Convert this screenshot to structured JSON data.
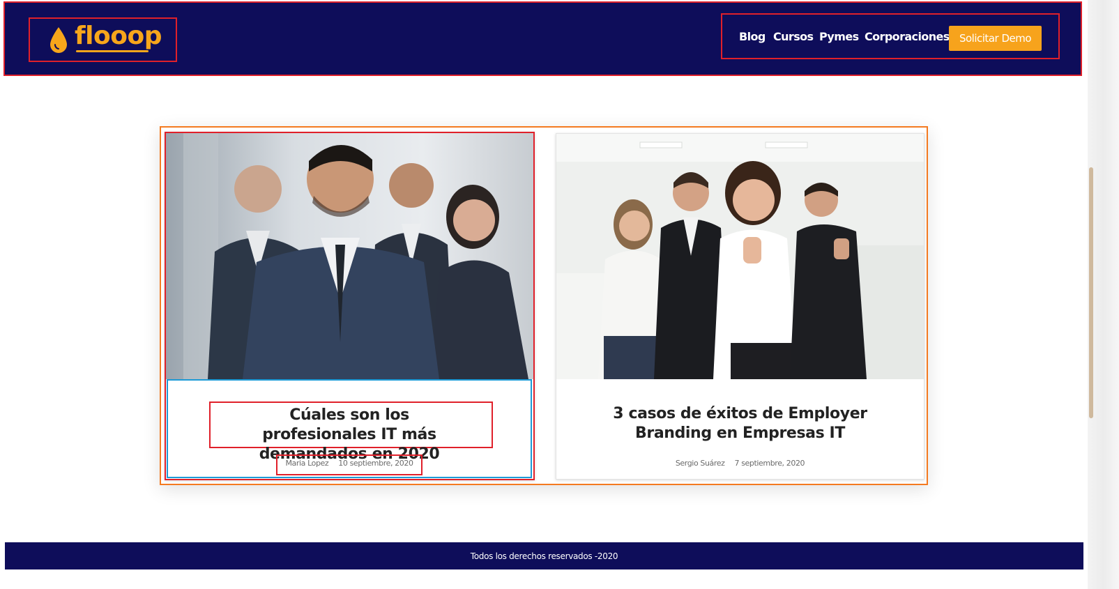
{
  "brand": {
    "name": "flooop",
    "color": "#f7a61b"
  },
  "colors": {
    "navy": "#0e0d5a",
    "accent": "#f7a31c",
    "highlight_red": "#e0202a",
    "highlight_orange": "#f47a20",
    "highlight_blue": "#1c9ad6"
  },
  "nav": {
    "items": [
      {
        "label": "Blog"
      },
      {
        "label": "Cursos"
      },
      {
        "label": "Pymes"
      },
      {
        "label": "Corporaciones"
      }
    ],
    "cta_label": "Solicitar Demo"
  },
  "posts": [
    {
      "title": "Cúales son los profesionales IT más demandados en 2020",
      "author": "Maria Lopez",
      "date": "10 septiembre, 2020",
      "image": "business-team-photo"
    },
    {
      "title": "3 casos de éxitos de Employer Branding en Empresas IT",
      "author": "Sergio Suárez",
      "date": "7 septiembre, 2020",
      "image": "office-team-thumbs-up-photo"
    }
  ],
  "footer": {
    "text": "Todos los derechos reservados -2020"
  }
}
